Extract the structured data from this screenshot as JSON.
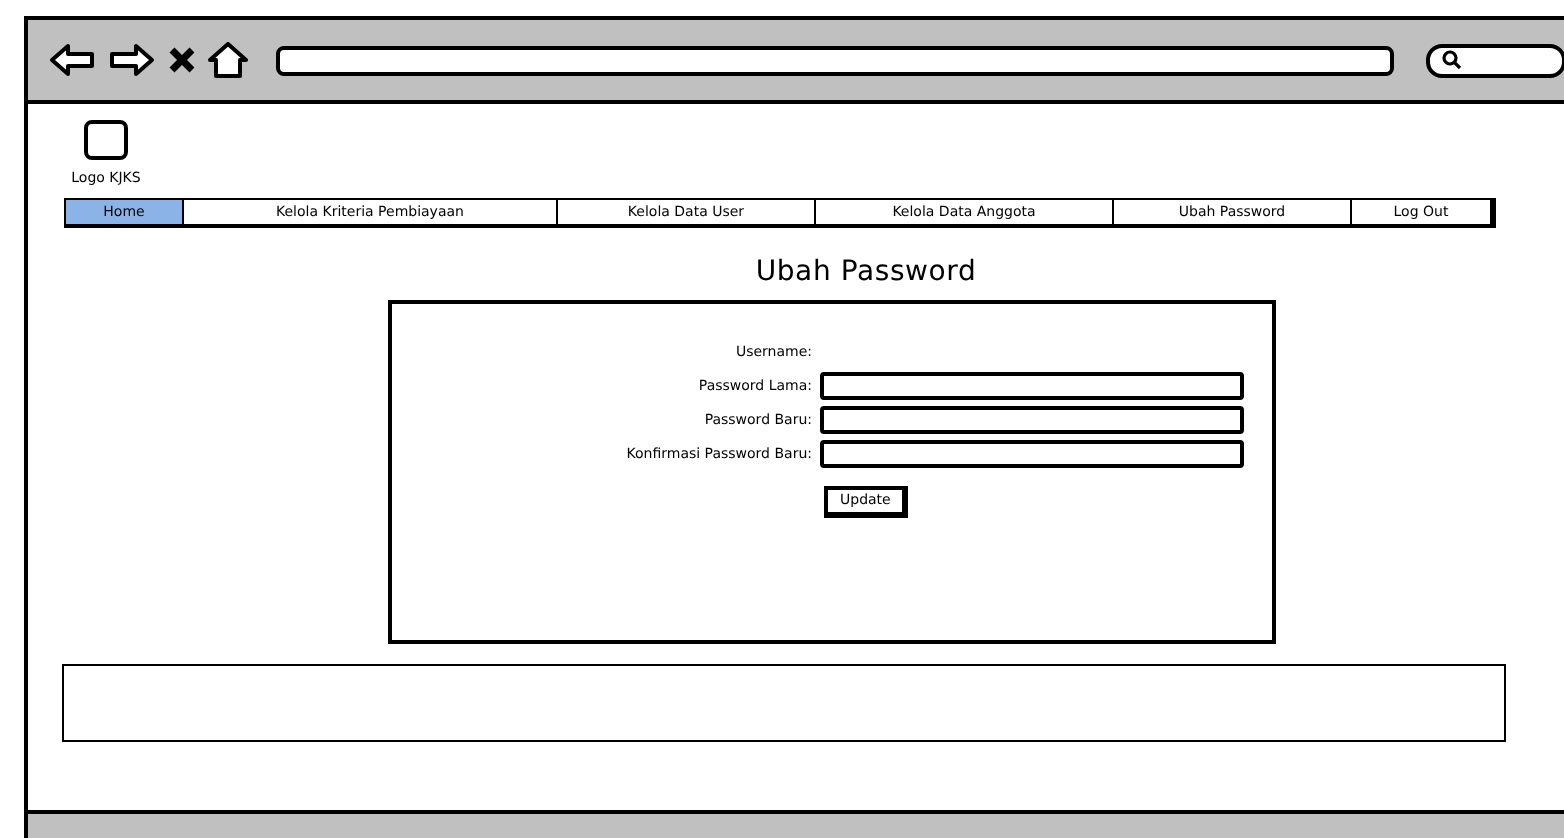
{
  "logo": {
    "label": "Logo KJKS"
  },
  "nav": [
    {
      "label": "Home",
      "selected": true
    },
    {
      "label": "Kelola Kriteria Pembiayaan",
      "selected": false
    },
    {
      "label": "Kelola Data User",
      "selected": false
    },
    {
      "label": "Kelola Data Anggota",
      "selected": false
    },
    {
      "label": "Ubah Password",
      "selected": false
    },
    {
      "label": "Log Out",
      "selected": false
    }
  ],
  "title": "Ubah Password",
  "form": {
    "rows": [
      {
        "kind": "label",
        "label": "Username:"
      },
      {
        "kind": "input",
        "label": "Password Lama:"
      },
      {
        "kind": "input",
        "label": "Password Baru:"
      },
      {
        "kind": "input",
        "label": "Konfirmasi Password Baru:"
      }
    ],
    "button": "Update"
  }
}
